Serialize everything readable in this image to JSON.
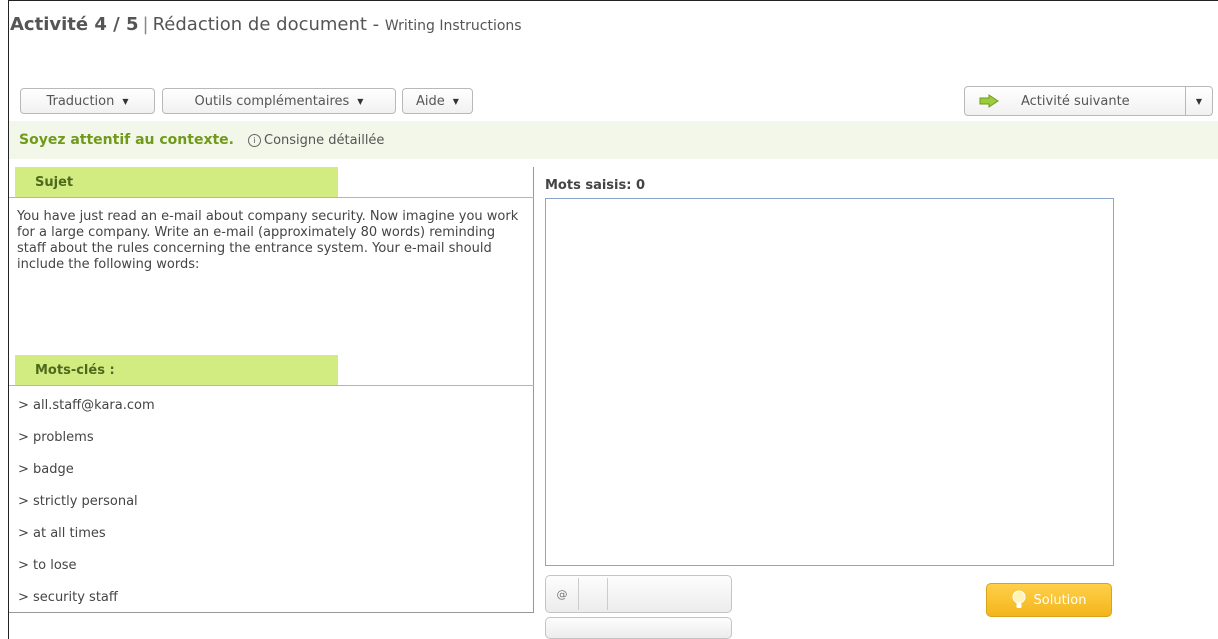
{
  "header": {
    "activity": "Activité 4 / 5",
    "separator": "|",
    "title": "Rédaction de document -",
    "subtitle": "Writing Instructions"
  },
  "toolbar": {
    "traduction": "Traduction",
    "outils": "Outils complémentaires",
    "aide": "Aide",
    "next": "Activité suivante"
  },
  "banner": {
    "hint": "Soyez attentif au contexte.",
    "consigne": "Consigne détaillée"
  },
  "sujet": {
    "heading": "Sujet",
    "text": "You have just read an e-mail about company security. Now imagine you work for a large company. Write an e-mail (approximately 80 words) reminding staff about the rules concerning the entrance system. Your e-mail should include the following words:"
  },
  "keywords": {
    "heading": "Mots-clés :",
    "items": [
      "> all.staff@kara.com",
      "> problems",
      "> badge",
      "> strictly personal",
      "> at all times",
      "> to lose",
      "> security staff"
    ]
  },
  "editor": {
    "word_count_label": "Mots saisis: 0"
  },
  "keyboard": {
    "at_symbol": "@"
  },
  "solution": {
    "label": "Solution"
  },
  "colors": {
    "tab_green": "#d3ec82",
    "hint_green": "#6f9a1a",
    "banner_bg": "#f3f7e9",
    "solution_yellow": "#f3b51c"
  }
}
